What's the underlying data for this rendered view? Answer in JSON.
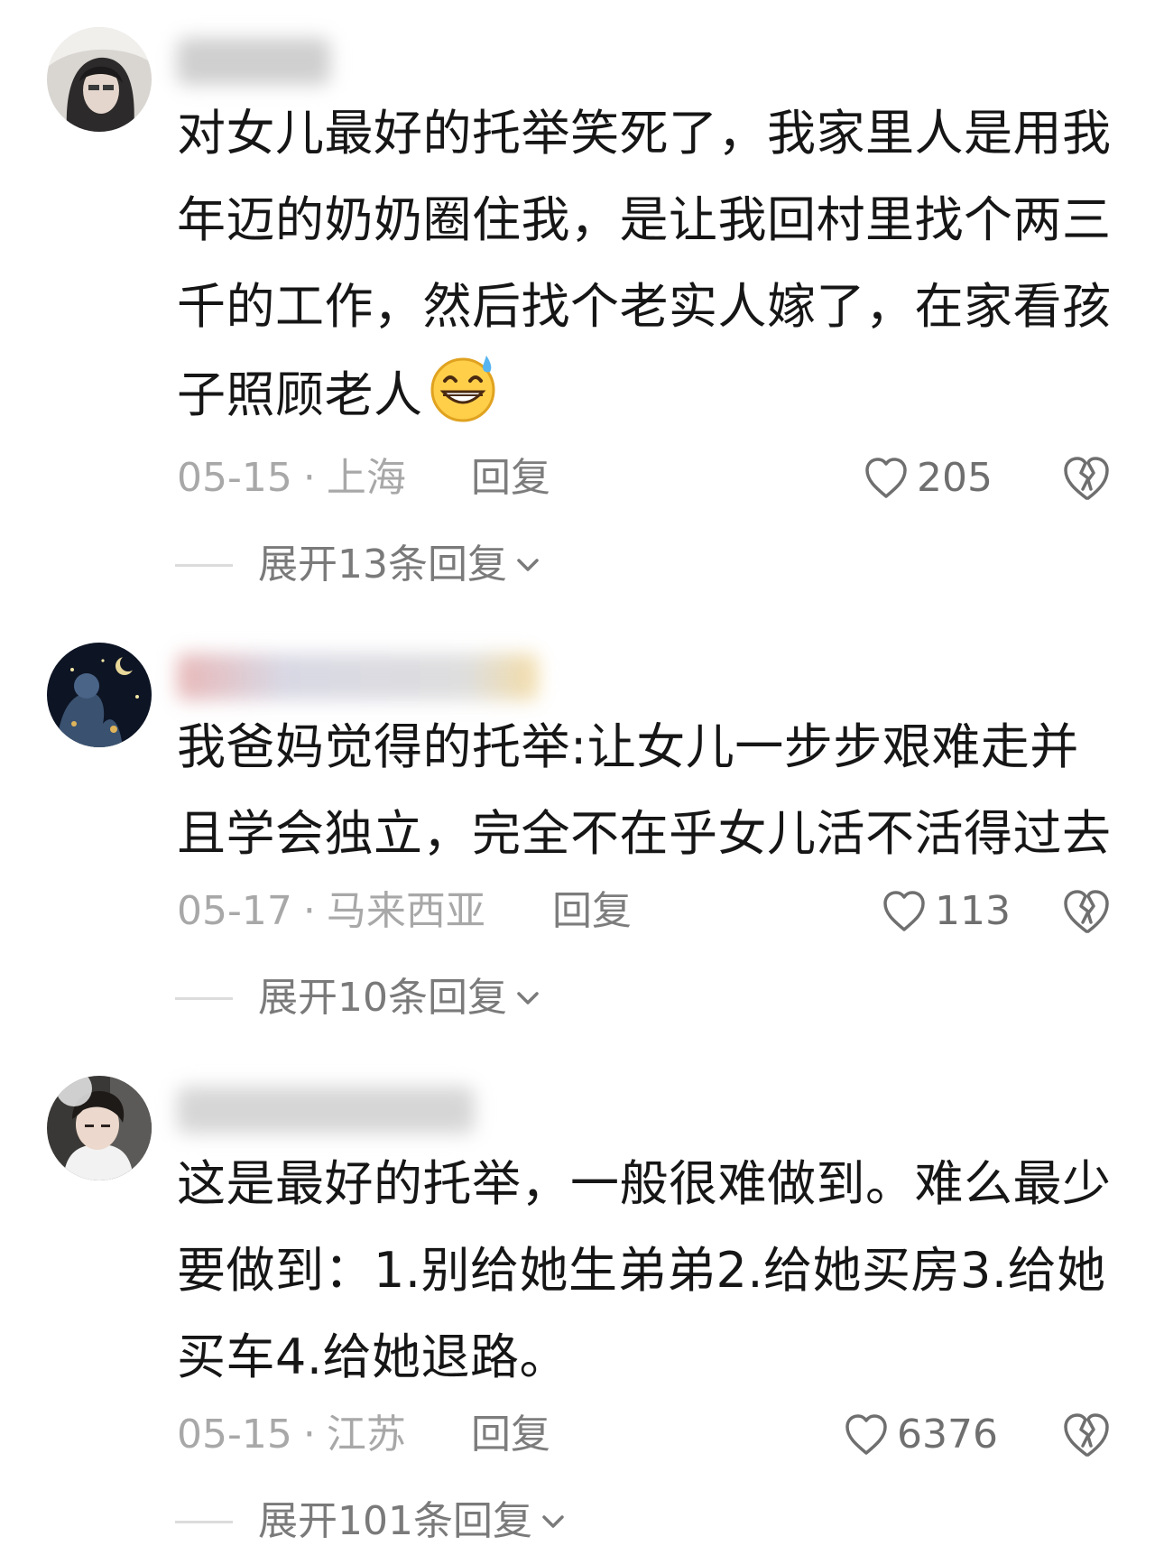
{
  "comments": [
    {
      "text": "对女儿最好的托举笑死了，我家里人是用我年迈的奶奶圈住我，是让我回村里找个两三千的工作，然后找个老实人嫁了，在家看孩子照顾老人",
      "emoji": "grinning-sweat-emoji",
      "date": "05-15",
      "location": "上海",
      "reply_label": "回复",
      "likes": "205",
      "expand_label": "展开13条回复"
    },
    {
      "text": "我爸妈觉得的托举:让女儿一步步艰难走并且学会独立，完全不在乎女儿活不活得过去",
      "date": "05-17",
      "location": "马来西亚",
      "reply_label": "回复",
      "likes": "113",
      "expand_label": "展开10条回复"
    },
    {
      "text": "这是最好的托举，一般很难做到。难么最少要做到：1.别给她生弟弟2.给她买房3.给她买车4.给她退路。",
      "date": "05-15",
      "location": "江苏",
      "reply_label": "回复",
      "likes": "6376",
      "expand_label": "展开101条回复"
    }
  ],
  "separator": "·",
  "icons": {
    "like": "heart-outline-icon",
    "dislike": "broken-heart-icon",
    "expand": "chevron-down-icon"
  },
  "colors": {
    "text": "#161616",
    "meta": "#a8a8a8",
    "reply": "#7d7d7d",
    "background": "#ffffff"
  }
}
